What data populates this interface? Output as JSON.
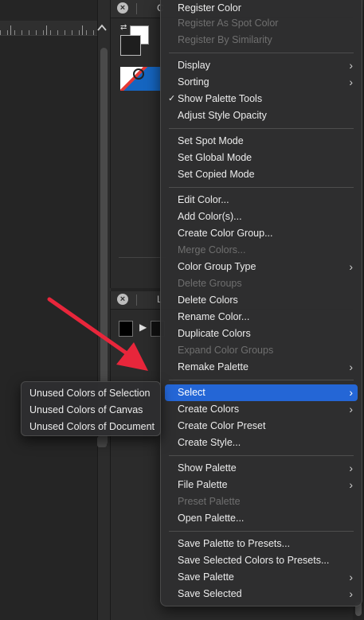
{
  "panels": {
    "top_tab_letter": "C",
    "bottom_tab_letter": "L"
  },
  "menu": {
    "items": [
      {
        "label": "Register Color",
        "disabled": false
      },
      {
        "label": "Register As Spot Color",
        "disabled": true
      },
      {
        "label": "Register By Similarity",
        "disabled": true
      },
      {
        "label": "Display",
        "disabled": false,
        "submenu": true
      },
      {
        "label": "Sorting",
        "disabled": false,
        "submenu": true
      },
      {
        "label": "Show Palette Tools",
        "disabled": false,
        "checked": true
      },
      {
        "label": "Adjust Style Opacity",
        "disabled": false
      },
      {
        "label": "Set Spot Mode",
        "disabled": false
      },
      {
        "label": "Set Global Mode",
        "disabled": false
      },
      {
        "label": "Set Copied Mode",
        "disabled": false
      },
      {
        "label": "Edit Color...",
        "disabled": false
      },
      {
        "label": "Add Color(s)...",
        "disabled": false
      },
      {
        "label": "Create Color Group...",
        "disabled": false
      },
      {
        "label": "Merge Colors...",
        "disabled": true
      },
      {
        "label": "Color Group Type",
        "disabled": false,
        "submenu": true
      },
      {
        "label": "Delete Groups",
        "disabled": true
      },
      {
        "label": "Delete Colors",
        "disabled": false
      },
      {
        "label": "Rename Color...",
        "disabled": false
      },
      {
        "label": "Duplicate Colors",
        "disabled": false
      },
      {
        "label": "Expand Color Groups",
        "disabled": true
      },
      {
        "label": "Remake Palette",
        "disabled": false,
        "submenu": true
      },
      {
        "label": "Select",
        "disabled": false,
        "submenu": true,
        "active": true
      },
      {
        "label": "Create Colors",
        "disabled": false,
        "submenu": true
      },
      {
        "label": "Create Color Preset",
        "disabled": false
      },
      {
        "label": "Create Style...",
        "disabled": false
      },
      {
        "label": "Show Palette",
        "disabled": false,
        "submenu": true
      },
      {
        "label": "File Palette",
        "disabled": false,
        "submenu": true
      },
      {
        "label": "Preset Palette",
        "disabled": true
      },
      {
        "label": "Open Palette...",
        "disabled": false
      },
      {
        "label": "Save Palette to Presets...",
        "disabled": false
      },
      {
        "label": "Save Selected Colors to Presets...",
        "disabled": false
      },
      {
        "label": "Save Palette",
        "disabled": false,
        "submenu": true
      },
      {
        "label": "Save Selected",
        "disabled": false,
        "submenu": true
      }
    ],
    "check_glyph": "✓",
    "submenu_glyph": "›"
  },
  "submenu": {
    "items": [
      "Unused Colors of Selection",
      "Unused Colors of Canvas",
      "Unused Colors of Document"
    ]
  },
  "colors": {
    "highlight": "#2466d6",
    "arrow": "#e8263b"
  }
}
